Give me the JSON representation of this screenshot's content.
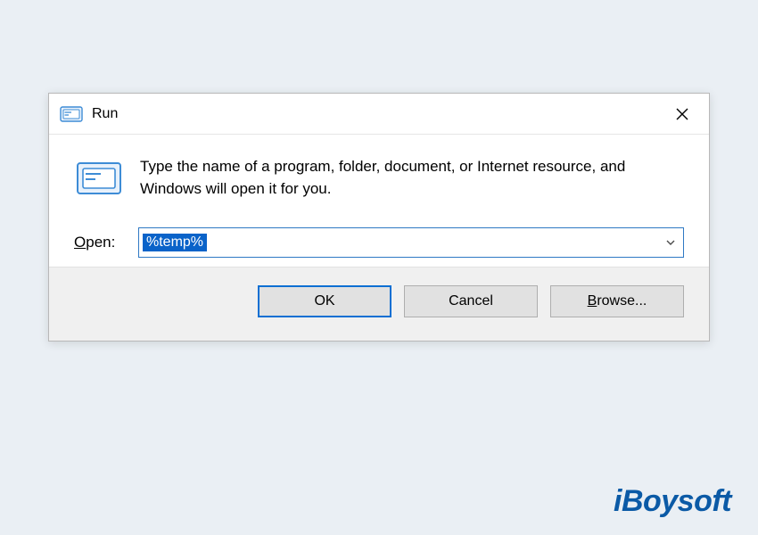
{
  "dialog": {
    "title": "Run",
    "description": "Type the name of a program, folder, document, or Internet resource, and Windows will open it for you.",
    "open_label_pre": "O",
    "open_label_post": "pen:",
    "input_value": "%temp%",
    "buttons": {
      "ok": "OK",
      "cancel": "Cancel",
      "browse_pre": "B",
      "browse_post": "rowse..."
    }
  },
  "watermark": "iBoysoft"
}
